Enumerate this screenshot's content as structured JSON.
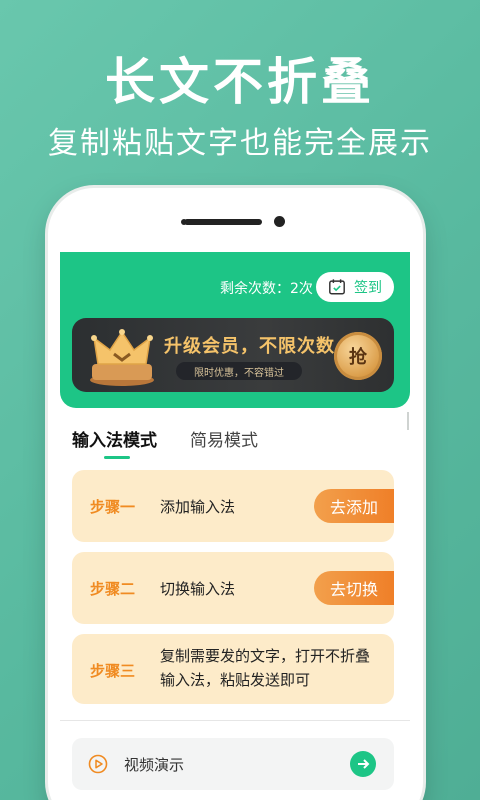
{
  "promo": {
    "title": "长文不折叠",
    "subtitle": "复制粘贴文字也能完全展示"
  },
  "header": {
    "remaining_text": "剩余次数：2次",
    "checkin_label": "签到",
    "checkin_icon": "calendar-check-icon"
  },
  "vip_banner": {
    "title": "升级会员，不限次数",
    "pill_text": "限时优惠，不容错过",
    "grab_label": "抢",
    "crown_icon": "crown-icon"
  },
  "tabs": [
    {
      "label": "输入法模式",
      "active": true
    },
    {
      "label": "简易模式",
      "active": false
    }
  ],
  "steps": [
    {
      "label": "步骤一",
      "desc": "添加输入法",
      "action": "去添加"
    },
    {
      "label": "步骤二",
      "desc": "切换输入法",
      "action": "去切换"
    },
    {
      "label": "步骤三",
      "desc": "复制需要发的文字，打开不折叠输入法，粘贴发送即可"
    }
  ],
  "video": {
    "label": "视频演示",
    "icon": "play-circle-icon",
    "arrow_icon": "arrow-right-icon"
  },
  "colors": {
    "brand_green": "#1dc586",
    "step_bg": "#fdebc9",
    "step_accent": "#f08b22",
    "vip_gold": "#f5c36a"
  }
}
